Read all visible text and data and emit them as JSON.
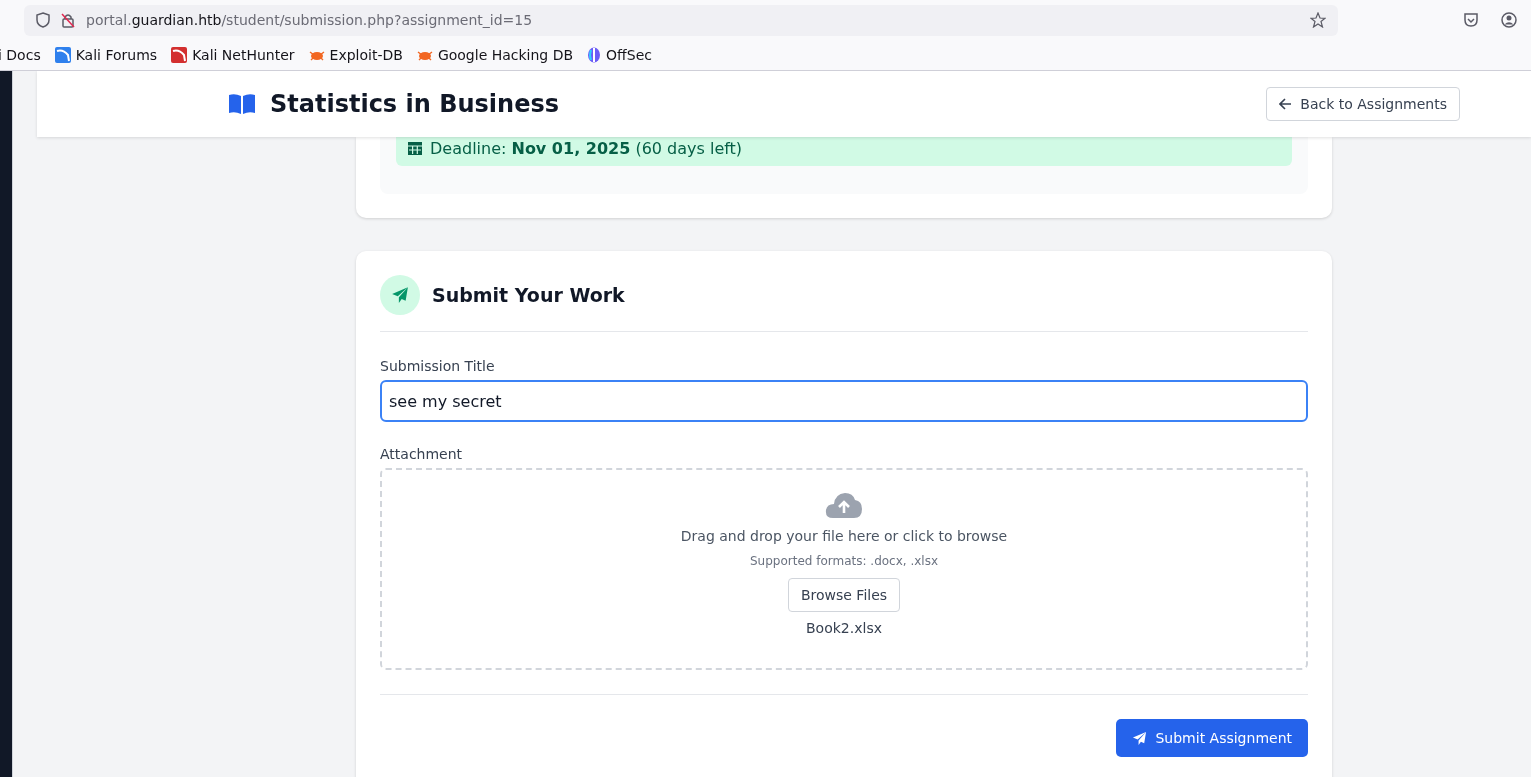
{
  "browser": {
    "url": {
      "subdomain": "portal.",
      "domain": "guardian.htb",
      "path": "/student/submission.php?assignment_id=15"
    },
    "bookmarks": [
      {
        "label": "i Docs",
        "kind": "none"
      },
      {
        "label": "Kali Forums",
        "kind": "kali"
      },
      {
        "label": "Kali NetHunter",
        "kind": "nethunter"
      },
      {
        "label": "Exploit-DB",
        "kind": "bug"
      },
      {
        "label": "Google Hacking DB",
        "kind": "bug"
      },
      {
        "label": "OffSec",
        "kind": "offsec"
      }
    ]
  },
  "header": {
    "title": "Statistics in Business",
    "back_button": "Back to Assignments"
  },
  "deadline": {
    "text": "Deadline: **Nov 01, 2025** (60 days left)"
  },
  "submit_card": {
    "title": "Submit Your Work",
    "title_field": {
      "label": "Submission Title",
      "value": "see my secret",
      "focused": true
    },
    "attachment": {
      "label": "Attachment",
      "hint": "Drag and drop your file here or click to browse",
      "formats": "Supported formats: .docx, .xlsx",
      "browse_button": "Browse Files",
      "file_name": "Book2.xlsx"
    },
    "submit_button": "Submit Assignment"
  }
}
